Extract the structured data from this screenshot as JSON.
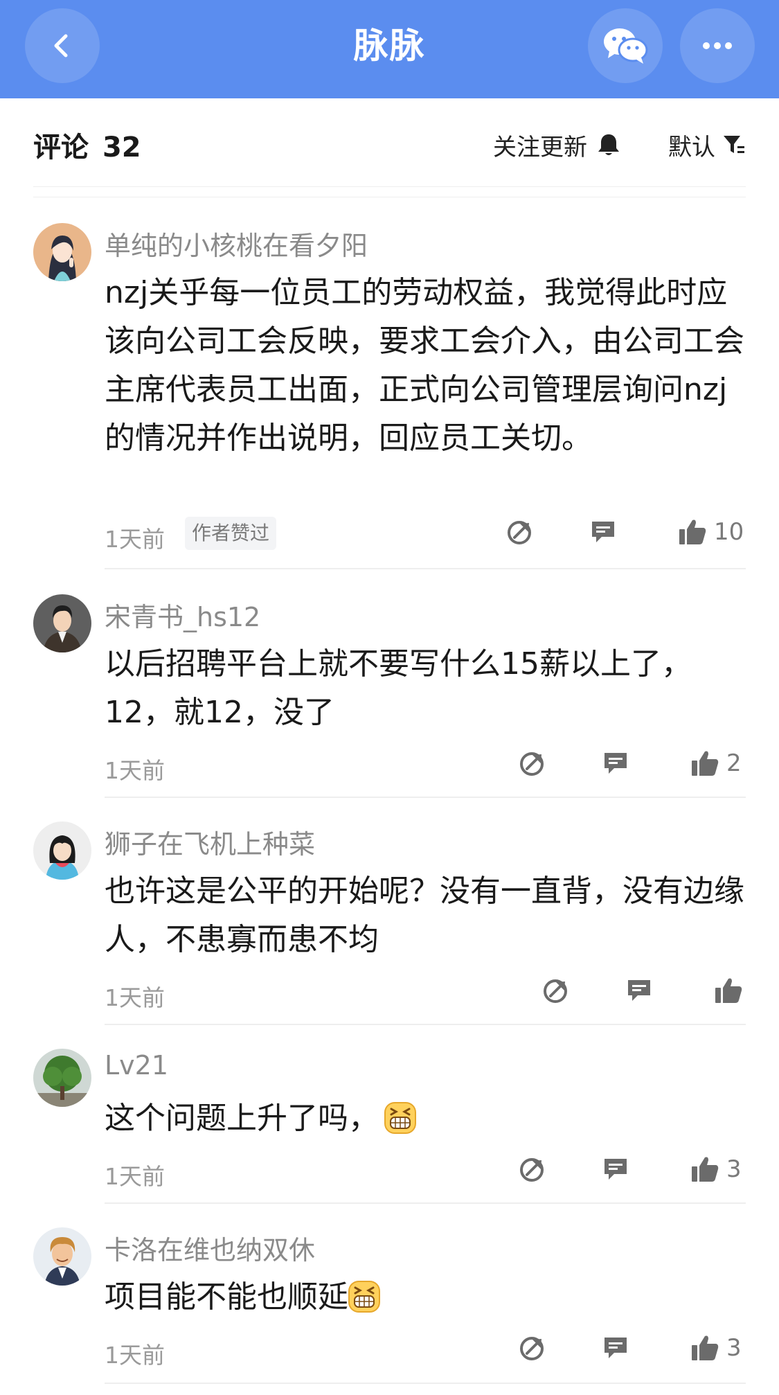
{
  "nav": {
    "title": "脉脉",
    "icons": [
      "back-chevron-icon",
      "wechat-icon",
      "more-dots-icon"
    ],
    "color": "#5b8def"
  },
  "comments_header": {
    "label": "评论",
    "count": "32",
    "follow_label": "关注更新",
    "sort_label": "默认"
  },
  "comments": [
    {
      "username": "单纯的小核桃在看夕阳",
      "text": "nzj关乎每一位员工的劳动权益，我觉得此时应该向公司工会反映，要求工会介入，由公司工会主席代表员工出面，正式向公司管理层询问nzj的情况并作出说明，回应员工关切。",
      "time": "1天前",
      "badge": "作者赞过",
      "likes": "10"
    },
    {
      "username": "宋青书_hs12",
      "text": "以后招聘平台上就不要写什么15薪以上了，12，就12，没了",
      "time": "1天前",
      "likes": "2"
    },
    {
      "username": "狮子在飞机上种菜",
      "text": "也许这是公平的开始呢？没有一直背，没有边缘人，不患寡而患不均",
      "time": "1天前",
      "likes": ""
    },
    {
      "username": "Lv21",
      "text": "这个问题上升了吗，",
      "emoji": "grin-emoji",
      "time": "1天前",
      "likes": "3"
    },
    {
      "username": "卡洛在维也纳双休",
      "text": "项目能不能也顺延",
      "emoji": "grin-emoji",
      "time": "1天前",
      "likes": "3"
    }
  ]
}
